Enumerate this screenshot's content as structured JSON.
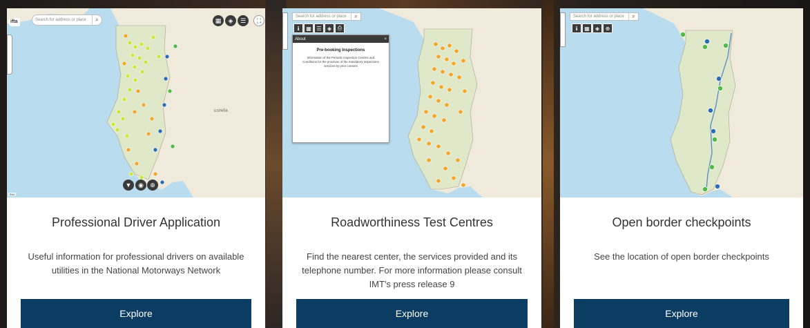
{
  "cards": [
    {
      "title": "Professional Driver Application",
      "description": "Useful information for professional drivers on available utilities in the National Motorways Network",
      "button": "Explore",
      "map": {
        "search_placeholder": "Search for address or place",
        "logo": "ifta",
        "marker_colors": [
          "#c6e83a",
          "#f2a62a",
          "#2c6bb5",
          "#53b848"
        ]
      }
    },
    {
      "title": "Roadworthiness Test Centres",
      "description": "Find the nearest center, the services provided and its telephone number. For more information please consult IMT's press release 9",
      "button": "Explore",
      "map": {
        "search_placeholder": "Search for address or place",
        "marker_colors": [
          "#f2a62a"
        ],
        "about": {
          "header": "About",
          "close": "×",
          "title": "Pre-booking Inspections",
          "text": "Information of the Periodic Inspection Centres and Conditions for the provision of the mandatory inspections services by prior consent"
        }
      }
    },
    {
      "title": "Open border checkpoints",
      "description": "See the location of open border checkpoints",
      "button": "Explore",
      "map": {
        "search_placeholder": "Search for address or place",
        "marker_colors": [
          "#2c6bb5",
          "#53b848"
        ]
      }
    }
  ],
  "colors": {
    "button_bg": "#0b3d63",
    "water": "#b9dcef",
    "land": "#f0eadc",
    "portugal": "#dfe8c8"
  }
}
